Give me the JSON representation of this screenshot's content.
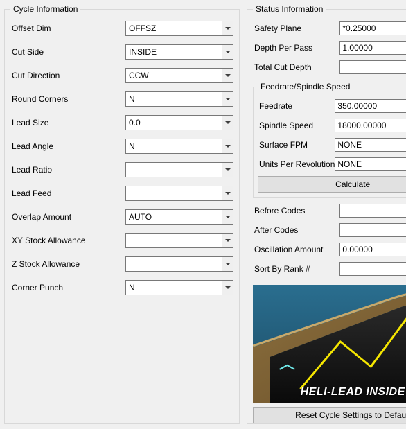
{
  "cycle_info": {
    "legend": "Cycle Information",
    "fields": {
      "offset_dim": {
        "label": "Offset Dim",
        "value": "OFFSZ"
      },
      "cut_side": {
        "label": "Cut Side",
        "value": "INSIDE"
      },
      "cut_direction": {
        "label": "Cut Direction",
        "value": "CCW"
      },
      "round_corners": {
        "label": "Round Corners",
        "value": "N"
      },
      "lead_size": {
        "label": "Lead Size",
        "value": "0.0"
      },
      "lead_angle": {
        "label": "Lead Angle",
        "value": "N"
      },
      "lead_ratio": {
        "label": "Lead Ratio",
        "value": ""
      },
      "lead_feed": {
        "label": "Lead Feed",
        "value": ""
      },
      "overlap_amount": {
        "label": "Overlap Amount",
        "value": "AUTO"
      },
      "xy_stock_allow": {
        "label": "XY Stock Allowance",
        "value": ""
      },
      "z_stock_allow": {
        "label": "Z Stock Allowance",
        "value": ""
      },
      "corner_punch": {
        "label": "Corner Punch",
        "value": "N"
      }
    }
  },
  "status_info": {
    "legend": "Status Information",
    "safety_plane": {
      "label": "Safety Plane",
      "value": "*0.25000"
    },
    "depth_per_pass": {
      "label": "Depth Per Pass",
      "value": "1.00000"
    },
    "total_cut_depth": {
      "label": "Total Cut Depth",
      "value": ""
    },
    "feed_group": {
      "legend": "Feedrate/Spindle Speed",
      "feedrate": {
        "label": "Feedrate",
        "value": "350.00000"
      },
      "spindle_speed": {
        "label": "Spindle Speed",
        "value": "18000.00000"
      },
      "surface_fpm": {
        "label": "Surface FPM",
        "value": "NONE"
      },
      "units_per_rev": {
        "label": "Units Per Revolution",
        "value": "NONE"
      },
      "calculate_btn": "Calculate"
    },
    "before_codes": {
      "label": "Before Codes",
      "value": ""
    },
    "after_codes": {
      "label": "After Codes",
      "value": ""
    },
    "oscillation_amount": {
      "label": "Oscillation Amount",
      "value": "0.00000"
    },
    "sort_by_rank": {
      "label": "Sort By Rank #",
      "value": ""
    },
    "preview_caption": "HELI-LEAD INSIDE",
    "reset_btn": "Reset Cycle Settings to Default"
  }
}
